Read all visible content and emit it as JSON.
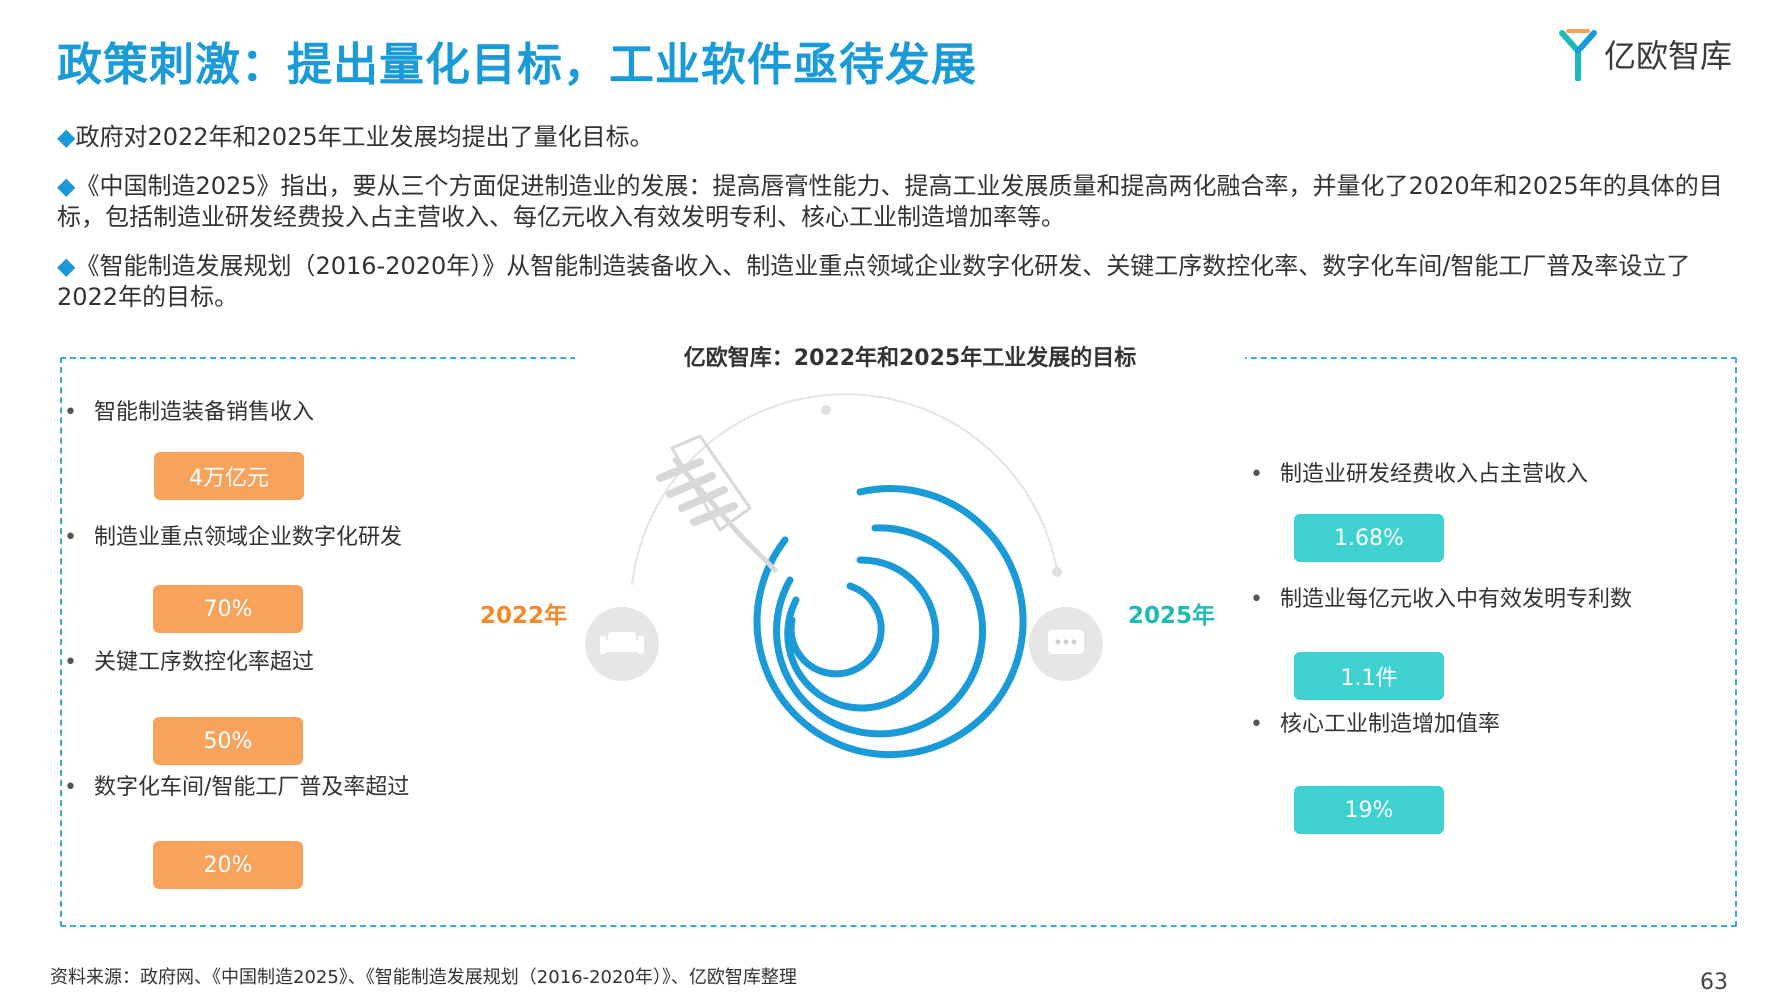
{
  "header": {
    "title": "政策刺激：提出量化目标，工业软件亟待发展",
    "logo_text": "亿欧智库"
  },
  "intro": {
    "bullet_symbol": "◆",
    "paragraphs": [
      "政府对2022年和2025年工业发展均提出了量化目标。",
      "《中国制造2025》指出，要从三个方面促进制造业的发展：提高唇膏性能力、提高工业发展质量和提高两化融合率，并量化了2020年和2025年的具体的目标，包括制造业研发经费投入占主营收入、每亿元收入有效发明专利、核心工业制造增加率等。",
      "《智能制造发展规划（2016-2020年）》从智能制造装备收入、制造业重点领域企业数字化研发、关键工序数控化率、数字化车间/智能工厂普及率设立了2022年的目标。"
    ]
  },
  "figure": {
    "title": "亿欧智库：2022年和2025年工业发展的目标",
    "bullet_mark": "•",
    "left": {
      "year_label": "2022年",
      "items": [
        {
          "label": "智能制造装备销售收入",
          "value": "4万亿元"
        },
        {
          "label": "制造业重点领域企业数字化研发",
          "value": "70%"
        },
        {
          "label": "关键工序数控化率超过",
          "value": "50%"
        },
        {
          "label": "数字化车间/智能工厂普及率超过",
          "value": "20%"
        }
      ]
    },
    "right": {
      "year_label": "2025年",
      "items": [
        {
          "label": "制造业研发经费收入占主营收入",
          "value": "1.68%"
        },
        {
          "label": "制造业每亿元收入中有效发明专利数",
          "value": "1.1件"
        },
        {
          "label": "核心工业制造增加值率",
          "value": "19%"
        }
      ]
    },
    "icons": [
      "target-icon",
      "arrow-icon",
      "sofa-icon",
      "chat-bubble-icon"
    ]
  },
  "footer": {
    "source": "资料来源：政府网、《中国制造2025》、《智能制造发展规划（2016-2020年）》、亿欧智库整理",
    "page_number": "63"
  },
  "colors": {
    "title_blue": "#1a9ad6",
    "orange": "#f7a35b",
    "teal": "#3fd1cf",
    "year_orange": "#f18a2a",
    "year_teal": "#1fbab6"
  }
}
